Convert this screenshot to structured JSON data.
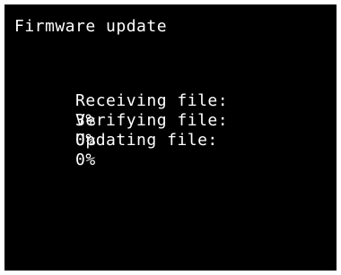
{
  "screen": {
    "title": "Firmware update",
    "status": [
      {
        "label": "Receiving file:",
        "value": "3%"
      },
      {
        "label": "Verifying file:",
        "value": "0%"
      },
      {
        "label": "Updating file:",
        "value": "0%"
      }
    ]
  },
  "colors": {
    "background": "#000000",
    "text": "#ffffff"
  }
}
